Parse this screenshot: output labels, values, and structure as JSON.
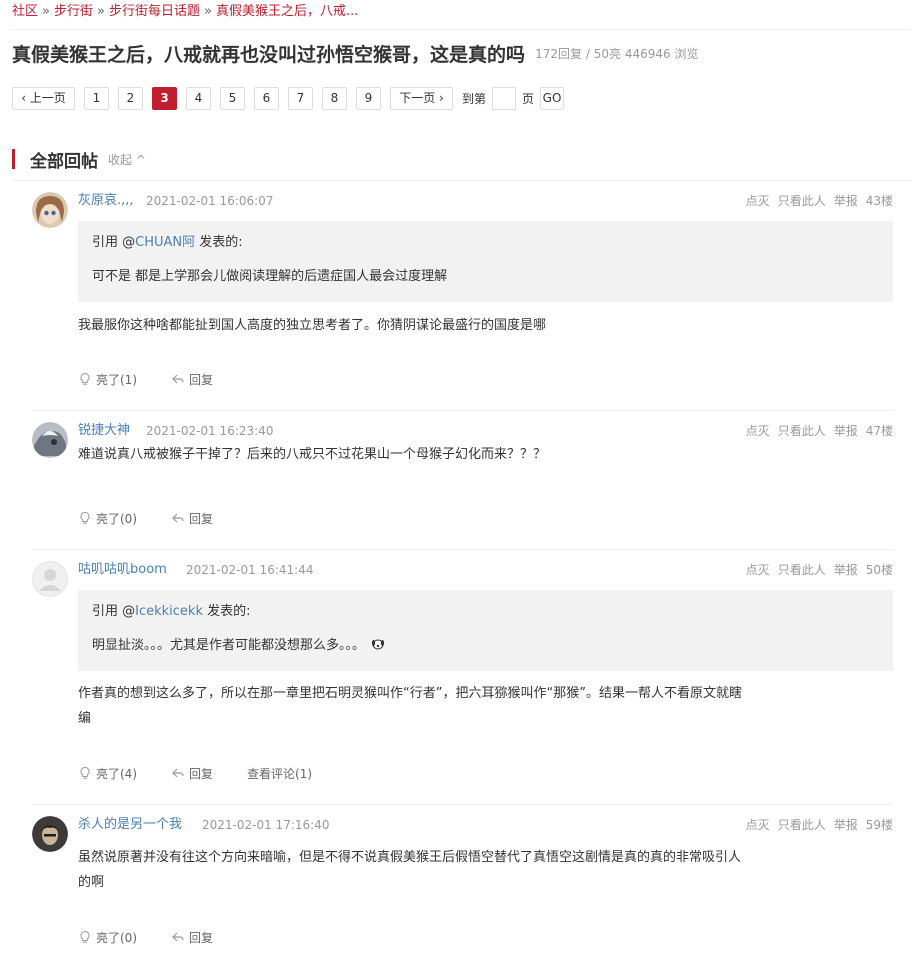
{
  "breadcrumb": {
    "items": [
      "社区",
      "步行街",
      "步行街每日话题",
      "真假美猴王之后，八戒..."
    ],
    "sep": "»"
  },
  "thread": {
    "title": "真假美猴王之后，八戒就再也没叫过孙悟空猴哥，这是真的吗",
    "stats": "172回复 / 50亮 446946 浏览"
  },
  "pager": {
    "prev": "‹ 上一页",
    "pages": [
      "1",
      "2",
      "3",
      "4",
      "5",
      "6",
      "7",
      "8",
      "9"
    ],
    "current": "3",
    "next": "下一页 ›",
    "goto_label": "到第",
    "page_unit": "页",
    "go": "GO"
  },
  "section": {
    "title": "全部回帖",
    "collapse": "收起 ^"
  },
  "actions": {
    "light_off": "点灭",
    "only_this": "只看此人",
    "report": "举报",
    "reply": "回复",
    "quote_prefix": "引用 @",
    "quote_suffix": " 发表的:"
  },
  "posts": [
    {
      "user": "灰原哀.,,,",
      "time": "2021-02-01 16:06:07",
      "floor": "43楼",
      "quote_user": "CHUAN阿",
      "quote_text": "可不是 都是上学那会儿做阅读理解的后遗症国人最会过度理解",
      "text": "我最服你这种啥都能扯到国人高度的独立思考者了。你猜阴谋论最盛行的国度是哪",
      "likes": "亮了(1)"
    },
    {
      "user": "锐捷大神",
      "time": "2021-02-01 16:23:40",
      "floor": "47楼",
      "text": "难道说真八戒被猴子干掉了？后来的八戒只不过花果山一个母猴子幻化而来？？？",
      "likes": "亮了(0)"
    },
    {
      "user": "咕叽咕叽boom",
      "time": "2021-02-01 16:41:44",
      "floor": "50楼",
      "quote_user": "Icekkicekk",
      "quote_text": "明显扯淡。。。尤其是作者可能都没想那么多。。。",
      "text": "作者真的想到这么多了，所以在那一章里把石明灵猴叫作“行者”，把六耳猕猴叫作“那猴”。结果一帮人不看原文就瞎编",
      "likes": "亮了(4)",
      "comments": "查看评论(1)"
    },
    {
      "user": "杀人的是另一个我",
      "time": "2021-02-01 17:16:40",
      "floor": "59楼",
      "text": "虽然说原著并没有往这个方向来暗喻，但是不得不说真假美猴王后假悟空替代了真悟空这剧情是真的真的非常吸引人的啊",
      "likes": "亮了(0)"
    }
  ],
  "colors": {
    "accent": "#c01e2f",
    "link": "#4a7fb7",
    "muted": "#999999",
    "quote_bg": "#f2f2f2"
  }
}
